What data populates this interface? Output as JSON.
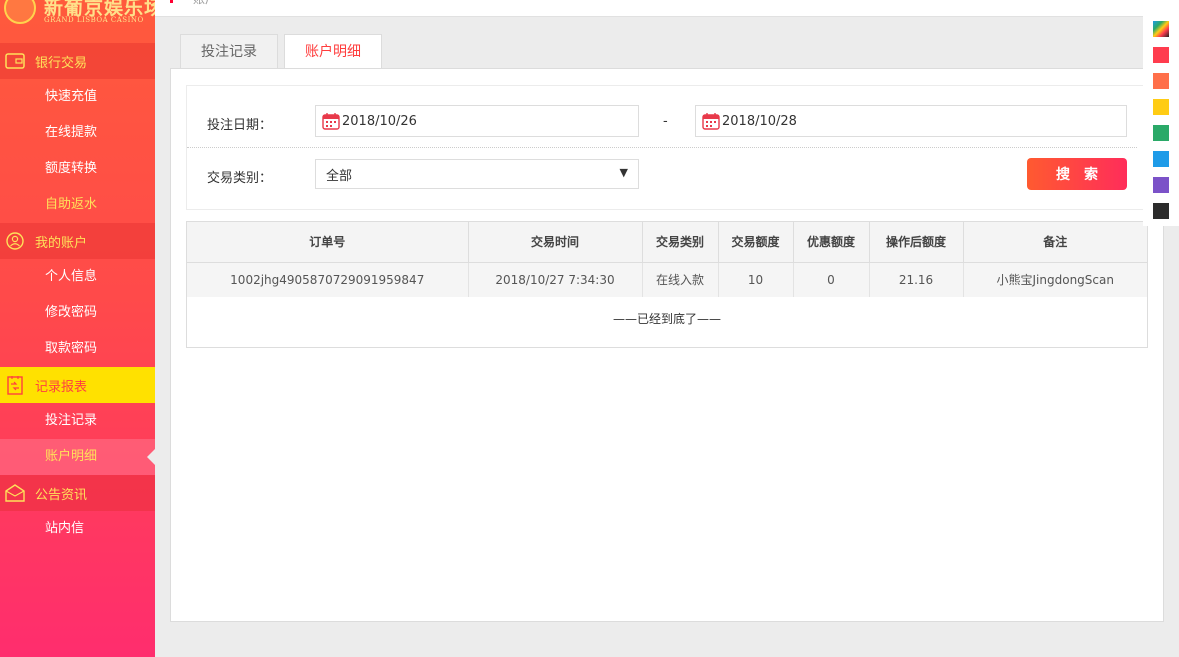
{
  "logo": {
    "cn": "新葡京娱乐场",
    "en": "GRAND LISBOA CASINO"
  },
  "topbar": {
    "text": "账户"
  },
  "sidebar": {
    "groups": [
      {
        "label": "银行交易",
        "icon": "wallet-icon",
        "items": [
          "快速充值",
          "在线提款",
          "额度转换",
          "自助返水"
        ]
      },
      {
        "label": "我的账户",
        "icon": "user-icon",
        "items": [
          "个人信息",
          "修改密码",
          "取款密码"
        ]
      },
      {
        "label": "记录报表",
        "icon": "report-icon",
        "items": [
          "投注记录",
          "账户明细"
        ]
      },
      {
        "label": "公告资讯",
        "icon": "mail-icon",
        "items": [
          "站内信"
        ]
      }
    ]
  },
  "tabs": [
    {
      "label": "投注记录"
    },
    {
      "label": "账户明细"
    }
  ],
  "filter": {
    "date_label": "投注日期：",
    "start_date": "2018/10/26",
    "separator": "-",
    "end_date": "2018/10/28",
    "type_label": "交易类别：",
    "type_value": "全部",
    "search_label": "搜索"
  },
  "table": {
    "headers": [
      "订单号",
      "交易时间",
      "交易类别",
      "交易额度",
      "优惠额度",
      "操作后额度",
      "备注"
    ],
    "rows": [
      [
        "1002jhg4905870729091959847",
        "2018/10/27 7:34:30",
        "在线入款",
        "10",
        "0",
        "21.16",
        "小熊宝JingdongScan"
      ]
    ],
    "end_note": "——已经到底了——"
  },
  "colors": {
    "accent": "#ff3d3d",
    "swatches": [
      "#ff3c4e",
      "#ff6f4a",
      "#ffcc14",
      "#2aa968",
      "#1e9be8",
      "#7b52c8",
      "#2c2c2c"
    ]
  }
}
